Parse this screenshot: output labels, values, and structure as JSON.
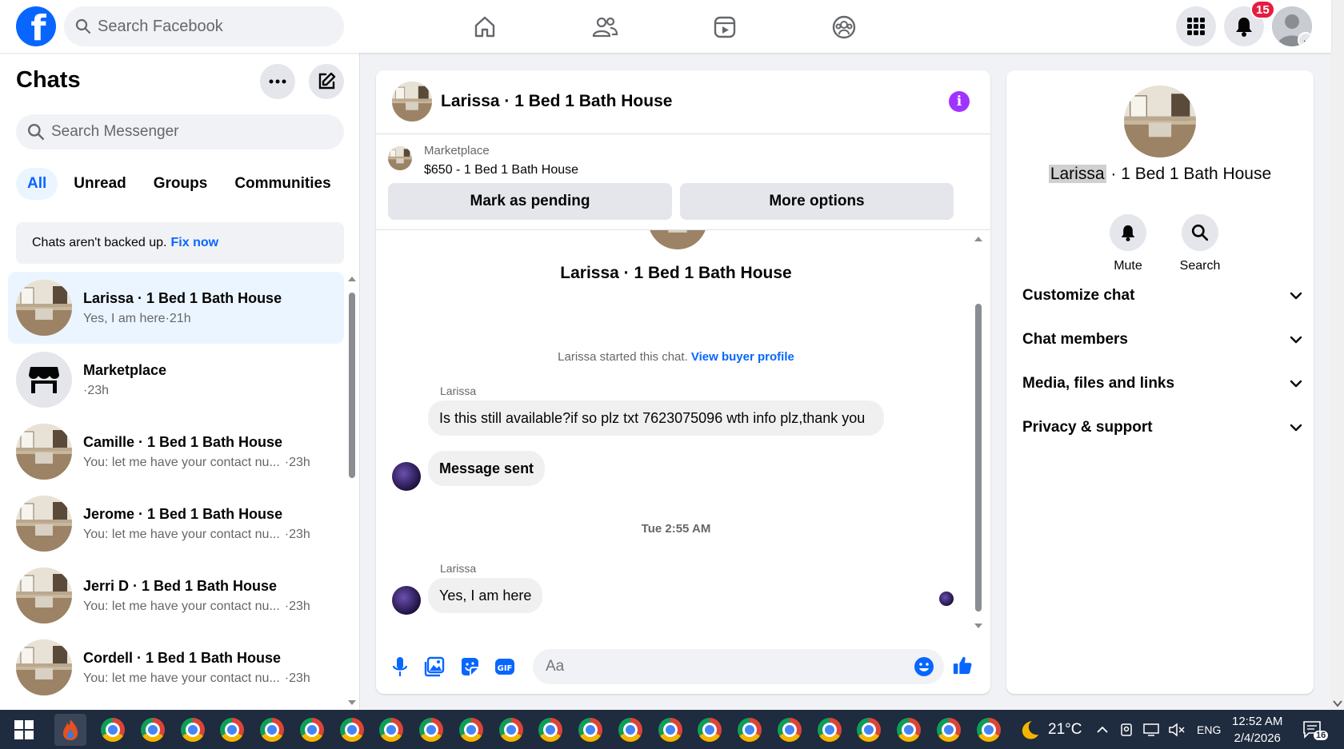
{
  "topbar": {
    "search_placeholder": "Search Facebook",
    "notifications_count": "15",
    "brand_color": "#0866ff"
  },
  "sidebar": {
    "title": "Chats",
    "search_placeholder": "Search Messenger",
    "filters": [
      "All",
      "Unread",
      "Groups",
      "Communities"
    ],
    "backup_text": "Chats aren't backed up.",
    "backup_link": "Fix now",
    "chats": [
      {
        "name": "Larissa · 1 Bed 1 Bath House",
        "preview": "Yes, I am here",
        "time": "·21h",
        "active": true
      },
      {
        "name": "Marketplace",
        "preview": "",
        "time": "·23h",
        "active": false
      },
      {
        "name": "Camille · 1 Bed 1 Bath House",
        "preview": "You: let me have your contact nu...",
        "time": "·23h",
        "active": false
      },
      {
        "name": "Jerome · 1 Bed 1 Bath House",
        "preview": "You: let me have your contact nu...",
        "time": "·23h",
        "active": false
      },
      {
        "name": "Jerri D · 1 Bed 1 Bath House",
        "preview": "You: let me have your contact nu...",
        "time": "·23h",
        "active": false
      },
      {
        "name": "Cordell · 1 Bed 1 Bath House",
        "preview": "You: let me have your contact nu...",
        "time": "·23h",
        "active": false
      }
    ]
  },
  "chat": {
    "title": "Larissa · 1 Bed 1 Bath House",
    "marketplace_label": "Marketplace",
    "listing": "$650 - 1 Bed 1 Bath House",
    "mark_pending": "Mark as pending",
    "more_options": "More options",
    "intro_name": "Larissa · 1 Bed 1 Bath House",
    "started_text": "Larissa started this chat.",
    "view_profile": "View buyer profile",
    "messages": [
      {
        "sender": "Larissa",
        "text": "Is this still available?if so plz txt 7623075096 wth info plz,thank you"
      },
      {
        "sender": "",
        "text": "Message sent"
      },
      {
        "sender": "Larissa",
        "text": "Yes, I am here"
      }
    ],
    "timestamp": "Tue 2:55 AM",
    "composer_placeholder": "Aa"
  },
  "details": {
    "name_highlight": "Larissa",
    "name_rest": " · 1 Bed 1 Bath House",
    "mute_label": "Mute",
    "search_label": "Search",
    "sections": [
      "Customize chat",
      "Chat members",
      "Media, files and links",
      "Privacy & support"
    ]
  },
  "taskbar": {
    "temperature": "21°C",
    "language": "ENG",
    "time": "12:52 AM",
    "date": "2/4/2026",
    "notification_count": "16"
  }
}
